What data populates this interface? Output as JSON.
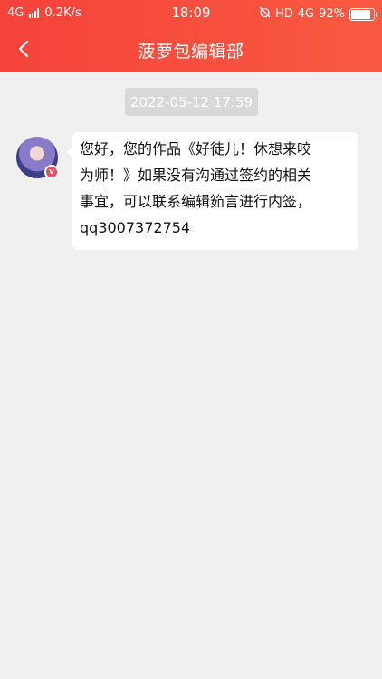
{
  "status_bar": {
    "network": "4G",
    "speed": "0.2K/s",
    "time": "18:09",
    "hd": "HD",
    "network_right": "4G",
    "battery": "92%"
  },
  "nav": {
    "title": "菠萝包编辑部"
  },
  "chat": {
    "timestamp": "2022-05-12 17:59",
    "sender_badge": "v",
    "message_lines": [
      "您好，您的作品《好徒儿！休想来咬",
      "为师！》如果没有沟通过签约的相关",
      "事宜，可以联系编辑筎言进行内签，",
      "qq3007372754"
    ]
  },
  "colors": {
    "header": "#f5423b",
    "background": "#f0f0f0"
  }
}
